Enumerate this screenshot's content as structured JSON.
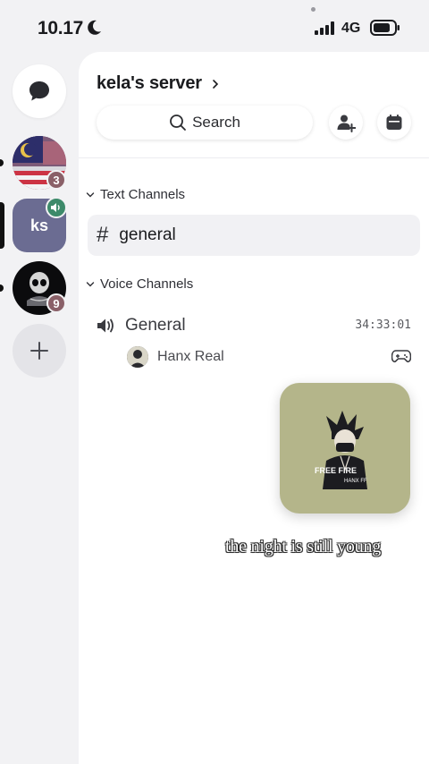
{
  "status_bar": {
    "time": "10.17",
    "network": "4G",
    "icons": [
      "moon-icon",
      "signal-icon",
      "battery-icon"
    ]
  },
  "server_rail": {
    "servers": [
      {
        "name": "flag-server",
        "unread_badge": "3"
      },
      {
        "name": "kela's server",
        "label": "ks",
        "active": true,
        "voice_active": true
      },
      {
        "name": "skull-server",
        "unread_badge": "9"
      }
    ],
    "icons": [
      "dm-bubble-icon",
      "plus-icon",
      "speaker-icon"
    ]
  },
  "header": {
    "server_name": "kela's server",
    "search_label": "Search",
    "icons": [
      "chevron-right-icon",
      "search-icon",
      "add-member-icon",
      "calendar-icon"
    ]
  },
  "categories": {
    "text": "Text Channels",
    "voice": "Voice Channels"
  },
  "text_channels": [
    {
      "name": "general",
      "prefix": "#",
      "selected": true
    }
  ],
  "voice_channels": [
    {
      "name": "General",
      "timer": "34:33:01",
      "users": [
        {
          "name": "Hanx Real",
          "activity_icon": "gamepad-icon"
        }
      ]
    }
  ],
  "video_tile": {
    "overlay_text": "FREE FIRE",
    "overlay_subtext": "HANX FF"
  },
  "caption": "the night is still young",
  "colors": {
    "active_server": "#6b6c92",
    "badge": "#8a6068",
    "voice_badge": "#3d8a6a",
    "video_tile_bg": "#b4b58a"
  }
}
